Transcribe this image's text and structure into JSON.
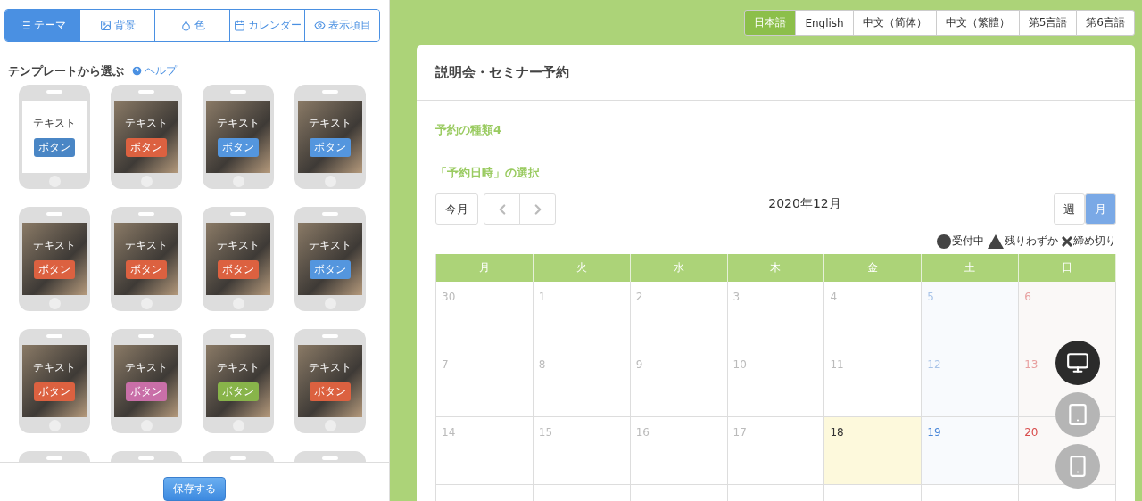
{
  "tabs": [
    {
      "label": "テーマ",
      "selected": true
    },
    {
      "label": "背景",
      "selected": false
    },
    {
      "label": "色",
      "selected": false
    },
    {
      "label": "カレンダー",
      "selected": false
    },
    {
      "label": "表示項目",
      "selected": false
    }
  ],
  "template_heading": "テンプレートから選ぶ",
  "help_link": "ヘルプ",
  "templates": [
    {
      "kind": "plain",
      "text": "テキスト",
      "button": "ボタン",
      "color": "#4a86c5"
    },
    {
      "kind": "photo",
      "text": "テキスト",
      "button": "ボタン",
      "color": "#dc6140"
    },
    {
      "kind": "photo",
      "text": "テキスト",
      "button": "ボタン",
      "color": "#5496de"
    },
    {
      "kind": "photo",
      "text": "テキスト",
      "button": "ボタン",
      "color": "#5496de"
    },
    {
      "kind": "photo",
      "text": "テキスト",
      "button": "ボタン",
      "color": "#dc6140"
    },
    {
      "kind": "photo",
      "text": "テキスト",
      "button": "ボタン",
      "color": "#dc6140"
    },
    {
      "kind": "photo",
      "text": "テキスト",
      "button": "ボタン",
      "color": "#dc6140"
    },
    {
      "kind": "photo",
      "text": "テキスト",
      "button": "ボタン",
      "color": "#5496de"
    },
    {
      "kind": "photo",
      "text": "テキスト",
      "button": "ボタン",
      "color": "#dc6140"
    },
    {
      "kind": "photo",
      "text": "テキスト",
      "button": "ボタン",
      "color": "#c96fa8"
    },
    {
      "kind": "photo",
      "text": "テキスト",
      "button": "ボタン",
      "color": "#88b44a"
    },
    {
      "kind": "photo",
      "text": "テキスト",
      "button": "ボタン",
      "color": "#dc6140"
    }
  ],
  "save_button": "保存する",
  "languages": [
    {
      "label": "日本語",
      "selected": true
    },
    {
      "label": "English",
      "selected": false
    },
    {
      "label": "中文（简体）",
      "selected": false
    },
    {
      "label": "中文（繁體）",
      "selected": false
    },
    {
      "label": "第5言語",
      "selected": false
    },
    {
      "label": "第6言語",
      "selected": false
    }
  ],
  "page_title": "説明会・セミナー予約",
  "reservation_type": "予約の種類4",
  "section_title": "「予約日時」の選択",
  "calendar": {
    "today_button": "今月",
    "month_label": "2020年12月",
    "views": [
      {
        "label": "週",
        "selected": false
      },
      {
        "label": "月",
        "selected": true
      }
    ],
    "legend": [
      {
        "kind": "circle",
        "label": "受付中"
      },
      {
        "kind": "triangle",
        "label": "残りわずか"
      },
      {
        "kind": "cross",
        "label": "締め切り"
      }
    ],
    "weekdays": [
      "月",
      "火",
      "水",
      "木",
      "金",
      "土",
      "日"
    ],
    "weeks": [
      [
        {
          "day": "30",
          "kind": "past"
        },
        {
          "day": "1",
          "kind": "past"
        },
        {
          "day": "2",
          "kind": "past"
        },
        {
          "day": "3",
          "kind": "past"
        },
        {
          "day": "4",
          "kind": "past"
        },
        {
          "day": "5",
          "kind": "past-sat"
        },
        {
          "day": "6",
          "kind": "past-sun"
        }
      ],
      [
        {
          "day": "7",
          "kind": "past"
        },
        {
          "day": "8",
          "kind": "past"
        },
        {
          "day": "9",
          "kind": "past"
        },
        {
          "day": "10",
          "kind": "past"
        },
        {
          "day": "11",
          "kind": "past"
        },
        {
          "day": "12",
          "kind": "past-sat"
        },
        {
          "day": "13",
          "kind": "past-sun"
        }
      ],
      [
        {
          "day": "14",
          "kind": "past"
        },
        {
          "day": "15",
          "kind": "past"
        },
        {
          "day": "16",
          "kind": "past"
        },
        {
          "day": "17",
          "kind": "past"
        },
        {
          "day": "18",
          "kind": "today"
        },
        {
          "day": "19",
          "kind": "sat"
        },
        {
          "day": "20",
          "kind": "sun"
        }
      ]
    ]
  },
  "devices": [
    {
      "kind": "desktop",
      "selected": true
    },
    {
      "kind": "tablet",
      "selected": false
    },
    {
      "kind": "phone",
      "selected": false
    }
  ]
}
